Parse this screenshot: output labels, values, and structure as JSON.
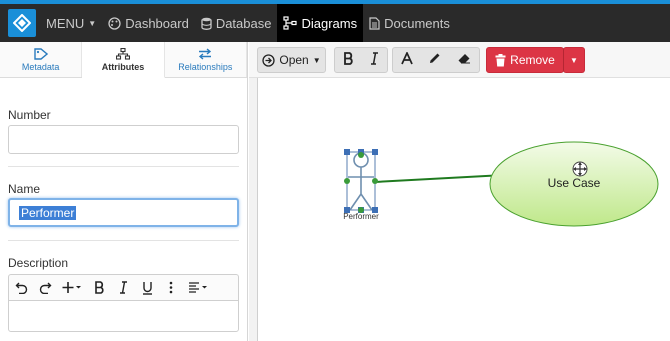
{
  "nav": {
    "menu_label": "MENU",
    "dashboard_label": "Dashboard",
    "database_label": "Database",
    "diagrams_label": "Diagrams",
    "documents_label": "Documents"
  },
  "tabs": [
    {
      "label": "Metadata",
      "icon": "tag-icon"
    },
    {
      "label": "Attributes",
      "icon": "sitemap-icon"
    },
    {
      "label": "Relationships",
      "icon": "arrows-icon"
    }
  ],
  "form": {
    "number_label": "Number",
    "number_value": "",
    "name_label": "Name",
    "name_value": "Performer",
    "description_label": "Description",
    "description_value": ""
  },
  "toolbar": {
    "open_label": "Open",
    "remove_label": "Remove"
  },
  "diagram": {
    "actor_label": "Performer",
    "usecase_label": "Use Case"
  },
  "colors": {
    "accent": "#1a8fd8",
    "nav_bg": "#2a2a2a",
    "remove": "#dc3545",
    "usecase_fill": "#c9ef9a",
    "connector": "#1f7a1f",
    "selection": "#3d7fd6"
  }
}
